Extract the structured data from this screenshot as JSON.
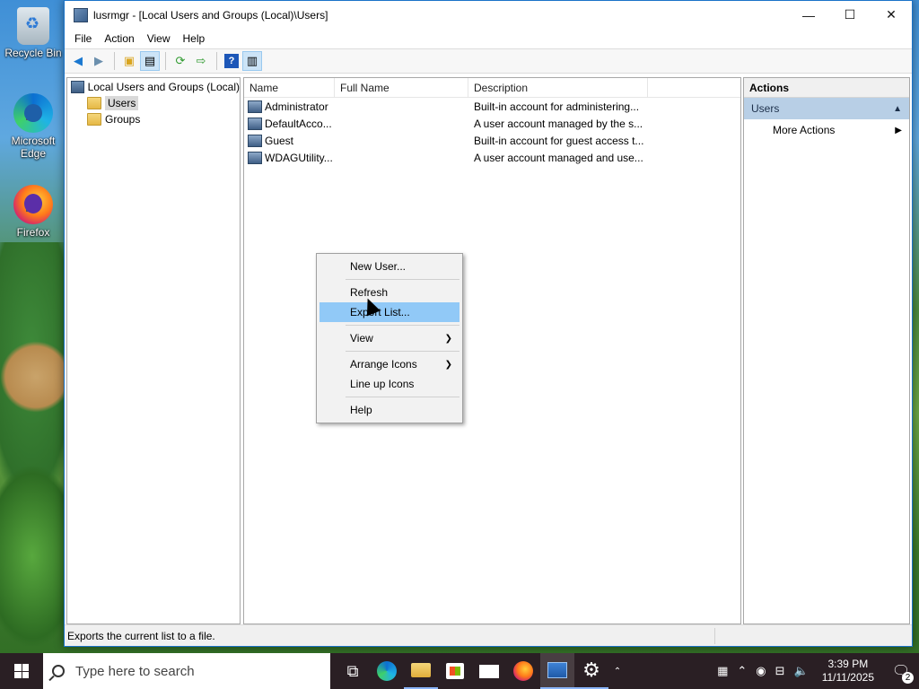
{
  "desktop": {
    "icons": [
      {
        "label": "Recycle Bin",
        "icon": "recycle-bin-icon"
      },
      {
        "label": "Microsoft Edge",
        "icon": "edge-icon"
      },
      {
        "label": "Firefox",
        "icon": "firefox-icon"
      }
    ]
  },
  "window": {
    "title": "lusrmgr - [Local Users and Groups (Local)\\Users]",
    "controls": {
      "minimize": "—",
      "maximize": "☐",
      "close": "✕"
    },
    "menu": [
      "File",
      "Action",
      "View",
      "Help"
    ],
    "toolbar": [
      "back-icon",
      "forward-icon",
      "up-folder-icon",
      "show-hide-tree-icon",
      "refresh-icon",
      "export-list-icon",
      "help-icon",
      "show-hide-action-pane-icon"
    ],
    "tree": {
      "root": "Local Users and Groups (Local)",
      "children": [
        "Users",
        "Groups"
      ],
      "selected": "Users"
    },
    "list": {
      "columns": [
        "Name",
        "Full Name",
        "Description"
      ],
      "rows": [
        {
          "name": "Administrator",
          "full_name": "",
          "description": "Built-in account for administering..."
        },
        {
          "name": "DefaultAcco...",
          "full_name": "",
          "description": "A user account managed by the s..."
        },
        {
          "name": "Guest",
          "full_name": "",
          "description": "Built-in account for guest access t..."
        },
        {
          "name": "WDAGUtility...",
          "full_name": "",
          "description": "A user account managed and use..."
        }
      ]
    },
    "actions": {
      "header": "Actions",
      "section": "Users",
      "items": [
        "More Actions"
      ]
    },
    "status": "Exports the current list to a file."
  },
  "context_menu": {
    "items": [
      {
        "label": "New User...",
        "submenu": false
      },
      {
        "label": "Refresh",
        "submenu": false
      },
      {
        "label": "Export List...",
        "submenu": false,
        "highlighted": true
      },
      {
        "label": "View",
        "submenu": true
      },
      {
        "label": "Arrange Icons",
        "submenu": true
      },
      {
        "label": "Line up Icons",
        "submenu": false
      },
      {
        "label": "Help",
        "submenu": false
      }
    ]
  },
  "taskbar": {
    "search_placeholder": "Type here to search",
    "time": "3:39 PM",
    "date": "11/11/2025",
    "notification_count": "2",
    "colors": {
      "accent": "#91c9f7",
      "taskbar": "#2a1f24"
    }
  }
}
